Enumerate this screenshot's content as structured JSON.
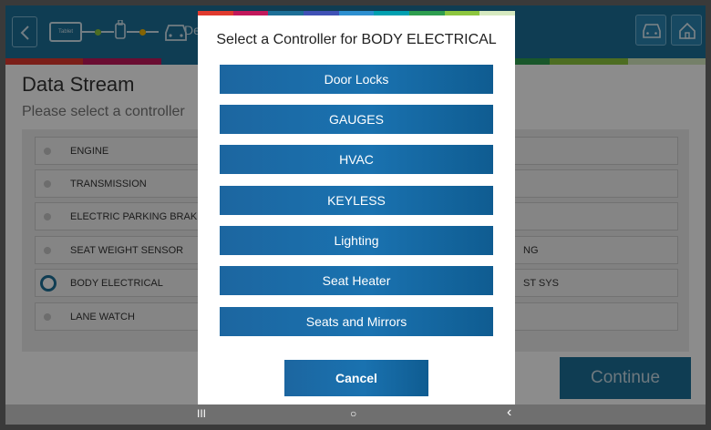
{
  "topbar": {
    "connection_tablet_label": "Tablet",
    "partial_title": "De"
  },
  "color_strip": [
    "#e03a2f",
    "#c2185b",
    "#1d6f97",
    "#3f51b5",
    "#2d8fd0",
    "#00a0b0",
    "#2e9e4f",
    "#8dc63f",
    "#d6e9c0"
  ],
  "page": {
    "heading": "Data Stream",
    "subheading": "Please select a controller"
  },
  "controllers": {
    "rows": [
      {
        "left": "ENGINE",
        "right": ""
      },
      {
        "left": "TRANSMISSION",
        "right": ""
      },
      {
        "left": "ELECTRIC PARKING BRAKE",
        "right": ""
      },
      {
        "left": "SEAT WEIGHT SENSOR",
        "right": "NG"
      },
      {
        "left": "BODY ELECTRICAL",
        "right": "ST SYS"
      },
      {
        "left": "LANE WATCH",
        "right": ""
      }
    ],
    "selected": "BODY ELECTRICAL"
  },
  "continue_label": "Continue",
  "dialog": {
    "title": "Select a Controller for BODY ELECTRICAL",
    "options": [
      "Door Locks",
      "GAUGES",
      "HVAC",
      "KEYLESS",
      "Lighting",
      "Seat Heater",
      "Seats and Mirrors"
    ],
    "cancel_label": "Cancel"
  },
  "navbar": {
    "recents_glyph": "III",
    "home_glyph": "○",
    "back_glyph": "‹"
  },
  "colors": {
    "primary": "#1d6f97",
    "button_blue": "#1a72b0"
  }
}
